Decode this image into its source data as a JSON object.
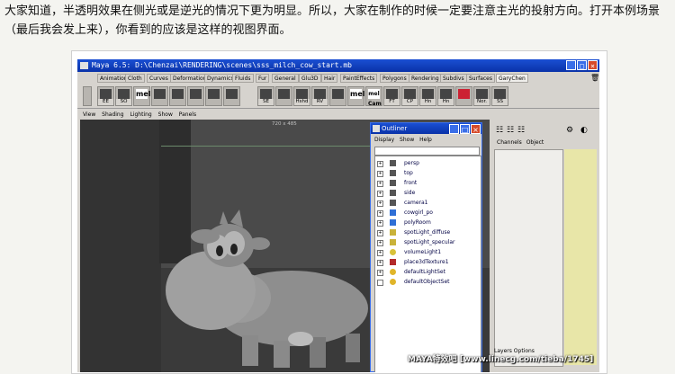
{
  "article": {
    "paragraph": "大家知道，半透明效果在侧光或是逆光的情况下更为明显。所以，大家在制作的时候一定要注意主光的投射方向。打开本例场景（最后我会发上来），你看到的应该是这样的视图界面。"
  },
  "window": {
    "title": "Maya 6.5: D:\\Chenzai\\RENDERING\\scenes\\sss_milch_cow_start.mb",
    "min": "_",
    "max": "□",
    "close": "×"
  },
  "shelf_tabs": [
    "Animation",
    "Cloth",
    "Curves",
    "Deformation",
    "Dynamics",
    "Fluids",
    "Fur",
    "General",
    "Glu3D",
    "Hair",
    "PaintEffects",
    "Polygons",
    "Rendering",
    "Subdivs",
    "Surfaces",
    "GaryChen"
  ],
  "shelf_icons": [
    "EE",
    "SO",
    "mel",
    "",
    "",
    "",
    "",
    "",
    "SE",
    "",
    "Hshd",
    "RV",
    "",
    "mel",
    "mel Cam",
    "FT",
    "CP",
    "Hn",
    "Hn",
    "",
    "Nor.",
    "SS"
  ],
  "viewport": {
    "menu": [
      "View",
      "Shading",
      "Lighting",
      "Show",
      "Panels"
    ],
    "resolution": "720 x 485"
  },
  "outliner": {
    "title": "Outliner",
    "menu": [
      "Display",
      "Show",
      "Help"
    ],
    "items": [
      "persp",
      "top",
      "front",
      "side",
      "camera1",
      "cowgirl_po",
      "polyRoom",
      "spotLight_diffuse",
      "spotLight_specular",
      "volumeLight1",
      "place3dTexture1",
      "defaultLightSet",
      "defaultObjectSet"
    ]
  },
  "channel_box": {
    "menu": [
      "Channels",
      "Object"
    ],
    "layers": [
      "Layers",
      "Options"
    ]
  },
  "watermark": "MAYA特效吧 [www.linecg.com/tieba/1745]",
  "colors": {
    "titlebar": "#0a32a8",
    "ui": "#d6d3ce",
    "viewport": "#3e3e3e"
  }
}
